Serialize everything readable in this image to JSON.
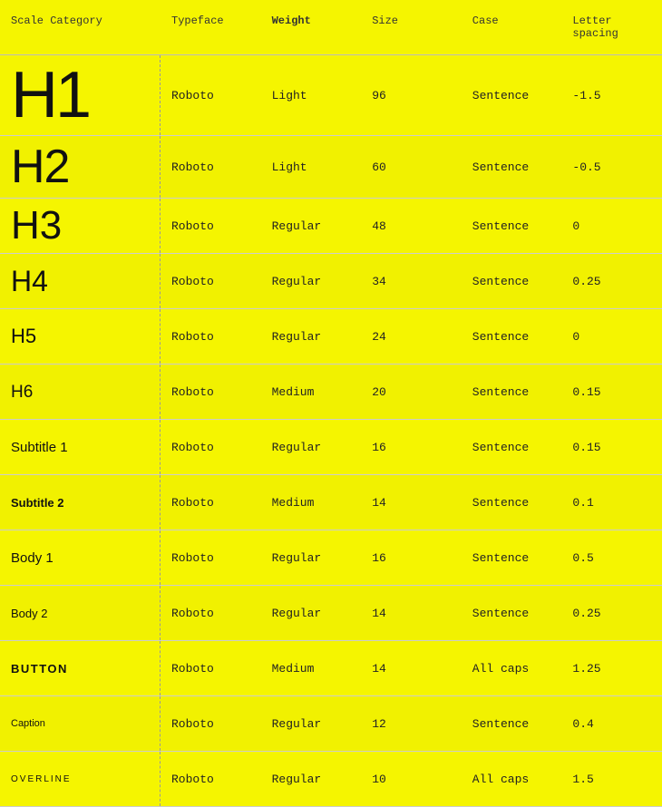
{
  "header": {
    "col1": "Scale Category",
    "col2": "Typeface",
    "col3": "Weight",
    "col4": "Size",
    "col5": "Case",
    "col6": "Letter spacing"
  },
  "rows": [
    {
      "scale": "H1",
      "scaleClass": "h1-label",
      "typeface": "Roboto",
      "weight": "Light",
      "size": "96",
      "case": "Sentence",
      "letterSpacing": "-1.5"
    },
    {
      "scale": "H2",
      "scaleClass": "h2-label",
      "typeface": "Roboto",
      "weight": "Light",
      "size": "60",
      "case": "Sentence",
      "letterSpacing": "-0.5"
    },
    {
      "scale": "H3",
      "scaleClass": "h3-label",
      "typeface": "Roboto",
      "weight": "Regular",
      "size": "48",
      "case": "Sentence",
      "letterSpacing": "0"
    },
    {
      "scale": "H4",
      "scaleClass": "h4-label",
      "typeface": "Roboto",
      "weight": "Regular",
      "size": "34",
      "case": "Sentence",
      "letterSpacing": "0.25"
    },
    {
      "scale": "H5",
      "scaleClass": "h5-label",
      "typeface": "Roboto",
      "weight": "Regular",
      "size": "24",
      "case": "Sentence",
      "letterSpacing": "0"
    },
    {
      "scale": "H6",
      "scaleClass": "h6-label",
      "typeface": "Roboto",
      "weight": "Medium",
      "size": "20",
      "case": "Sentence",
      "letterSpacing": "0.15"
    },
    {
      "scale": "Subtitle 1",
      "scaleClass": "subtitle1-label",
      "typeface": "Roboto",
      "weight": "Regular",
      "size": "16",
      "case": "Sentence",
      "letterSpacing": "0.15"
    },
    {
      "scale": "Subtitle 2",
      "scaleClass": "subtitle2-label",
      "typeface": "Roboto",
      "weight": "Medium",
      "size": "14",
      "case": "Sentence",
      "letterSpacing": "0.1"
    },
    {
      "scale": "Body 1",
      "scaleClass": "body1-label",
      "typeface": "Roboto",
      "weight": "Regular",
      "size": "16",
      "case": "Sentence",
      "letterSpacing": "0.5"
    },
    {
      "scale": "Body 2",
      "scaleClass": "body2-label",
      "typeface": "Roboto",
      "weight": "Regular",
      "size": "14",
      "case": "Sentence",
      "letterSpacing": "0.25"
    },
    {
      "scale": "BUTTON",
      "scaleClass": "button-label",
      "typeface": "Roboto",
      "weight": "Medium",
      "size": "14",
      "case": "All caps",
      "letterSpacing": "1.25"
    },
    {
      "scale": "Caption",
      "scaleClass": "caption-label",
      "typeface": "Roboto",
      "weight": "Regular",
      "size": "12",
      "case": "Sentence",
      "letterSpacing": "0.4"
    },
    {
      "scale": "OVERLINE",
      "scaleClass": "overline-label",
      "typeface": "Roboto",
      "weight": "Regular",
      "size": "10",
      "case": "All caps",
      "letterSpacing": "1.5"
    }
  ]
}
